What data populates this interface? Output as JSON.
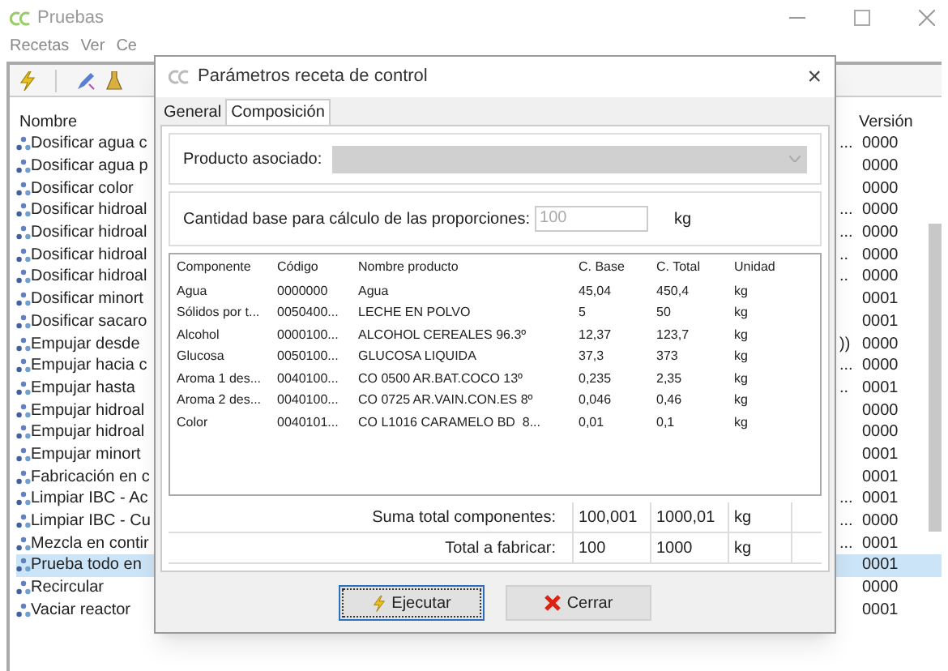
{
  "window": {
    "title": "Pruebas"
  },
  "menu": [
    "Recetas",
    "Ver",
    "Ce"
  ],
  "list": {
    "columns": [
      "Nombre",
      "Versión"
    ],
    "rows": [
      {
        "name": "Dosificar agua c",
        "column_2": "...",
        "version": "0000",
        "selected": false
      },
      {
        "name": "Dosificar agua p",
        "column_2": "",
        "version": "0000",
        "selected": false
      },
      {
        "name": "Dosificar color",
        "column_2": "",
        "version": "0000",
        "selected": false
      },
      {
        "name": "Dosificar hidroal",
        "column_2": "...",
        "version": "0000",
        "selected": false
      },
      {
        "name": "Dosificar hidroal",
        "column_2": "...",
        "version": "0000",
        "selected": false
      },
      {
        "name": "Dosificar hidroal",
        "column_2": "..",
        "version": "0000",
        "selected": false
      },
      {
        "name": "Dosificar hidroal",
        "column_2": "..",
        "version": "0000",
        "selected": false
      },
      {
        "name": "Dosificar minort",
        "column_2": "",
        "version": "0001",
        "selected": false
      },
      {
        "name": "Dosificar sacaro",
        "column_2": "",
        "version": "0001",
        "selected": false
      },
      {
        "name": "Empujar desde",
        "column_2": "))",
        "version": "0000",
        "selected": false
      },
      {
        "name": "Empujar hacia c",
        "column_2": "...",
        "version": "0000",
        "selected": false
      },
      {
        "name": "Empujar hasta",
        "column_2": "..",
        "version": "0001",
        "selected": false
      },
      {
        "name": "Empujar hidroal",
        "column_2": "",
        "version": "0000",
        "selected": false
      },
      {
        "name": "Empujar hidroal",
        "column_2": "",
        "version": "0000",
        "selected": false
      },
      {
        "name": "Empujar minort",
        "column_2": "",
        "version": "0001",
        "selected": false
      },
      {
        "name": "Fabricación en c",
        "column_2": "",
        "version": "0001",
        "selected": false
      },
      {
        "name": "Limpiar IBC - Ac",
        "column_2": "...",
        "version": "0001",
        "selected": false
      },
      {
        "name": "Limpiar IBC - Cu",
        "column_2": "...",
        "version": "0000",
        "selected": false
      },
      {
        "name": "Mezcla en contir",
        "column_2": "...",
        "version": "0001",
        "selected": false
      },
      {
        "name": "Prueba todo en",
        "column_2": "",
        "version": "0001",
        "selected": true
      },
      {
        "name": "Recircular",
        "column_2": "",
        "version": "0000",
        "selected": false
      },
      {
        "name": "Vaciar reactor",
        "column_2": "",
        "version": "0001",
        "selected": false
      }
    ]
  },
  "dialog": {
    "title": "Parámetros receta de control",
    "close": "×",
    "tabs": [
      {
        "label": "General",
        "selected": false
      },
      {
        "label": "Composición",
        "selected": true
      }
    ],
    "product_label": "Producto asociado:",
    "base_label": "Cantidad base para cálculo de las proporciones:",
    "base_value": "100",
    "base_unit": "kg",
    "table": {
      "columns": [
        "Componente",
        "Código",
        "Nombre producto",
        "C. Base",
        "C. Total",
        "Unidad"
      ],
      "rows": [
        [
          "Agua",
          "0000000",
          "Agua",
          "45,04",
          "450,4",
          "kg"
        ],
        [
          "Sólidos por t...",
          "0050400...",
          "LECHE EN POLVO",
          "5",
          "50",
          "kg"
        ],
        [
          "Alcohol",
          "0000100...",
          "ALCOHOL CEREALES 96.3º",
          "12,37",
          "123,7",
          "kg"
        ],
        [
          "Glucosa",
          "0050100...",
          "GLUCOSA LIQUIDA",
          "37,3",
          "373",
          "kg"
        ],
        [
          "Aroma 1 des...",
          "0040100...",
          "CO 0500 AR.BAT.COCO 13º",
          "0,235",
          "2,35",
          "kg"
        ],
        [
          "Aroma 2 des...",
          "0040100...",
          "CO 0725 AR.VAIN.CON.ES 8º",
          "0,046",
          "0,46",
          "kg"
        ],
        [
          "Color",
          "0040101...",
          "CO L1016 CARAMELO BD  8...",
          "0,01",
          "0,1",
          "kg"
        ]
      ]
    },
    "totals": [
      {
        "label": "Suma total componentes:",
        "base": "100,001",
        "total": "1000,01",
        "unit": "kg"
      },
      {
        "label": "Total a fabricar:",
        "base": "100",
        "total": "1000",
        "unit": "kg"
      }
    ],
    "buttons": [
      {
        "kind": "execute",
        "label": "Ejecutar",
        "focused": true
      },
      {
        "kind": "close",
        "label": "Cerrar",
        "focused": false
      }
    ]
  }
}
